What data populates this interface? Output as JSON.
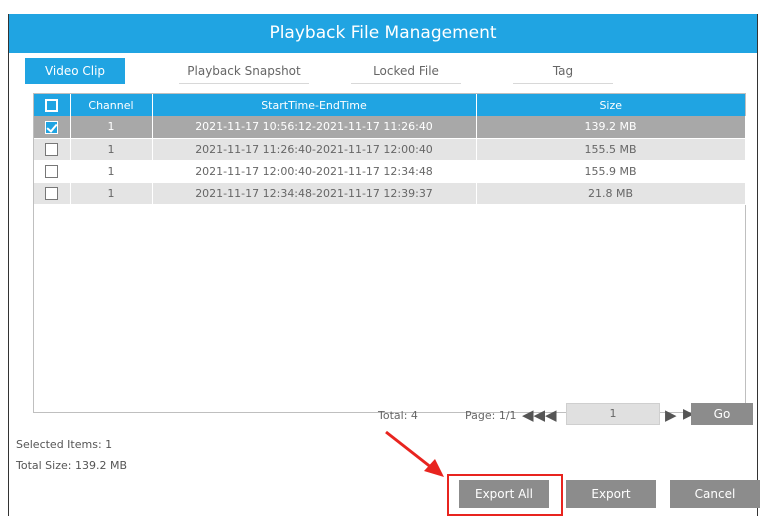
{
  "window": {
    "title": "Playback File Management"
  },
  "tabs": [
    {
      "label": "Video Clip",
      "active": true
    },
    {
      "label": "Playback Snapshot",
      "active": false
    },
    {
      "label": "Locked File",
      "active": false
    },
    {
      "label": "Tag",
      "active": false
    }
  ],
  "table": {
    "headers": [
      "Channel",
      "StartTime-EndTime",
      "Size"
    ],
    "rows": [
      {
        "checked": true,
        "channel": "1",
        "time": "2021-11-17 10:56:12-2021-11-17 11:26:40",
        "size": "139.2 MB"
      },
      {
        "checked": false,
        "channel": "1",
        "time": "2021-11-17 11:26:40-2021-11-17 12:00:40",
        "size": "155.5 MB"
      },
      {
        "checked": false,
        "channel": "1",
        "time": "2021-11-17 12:00:40-2021-11-17 12:34:48",
        "size": "155.9 MB"
      },
      {
        "checked": false,
        "channel": "1",
        "time": "2021-11-17 12:34:48-2021-11-17 12:39:37",
        "size": "21.8 MB"
      }
    ]
  },
  "pager": {
    "total": "Total: 4",
    "page": "Page: 1/1",
    "page_input": "1",
    "go_label": "Go"
  },
  "info": {
    "selected": "Selected Items: 1",
    "total_size": "Total Size: 139.2 MB"
  },
  "buttons": {
    "export_all": "Export All",
    "export": "Export",
    "cancel": "Cancel"
  },
  "colors": {
    "accent": "#20a4e2",
    "button": "#8c8c8c",
    "highlight": "#e8241f"
  }
}
